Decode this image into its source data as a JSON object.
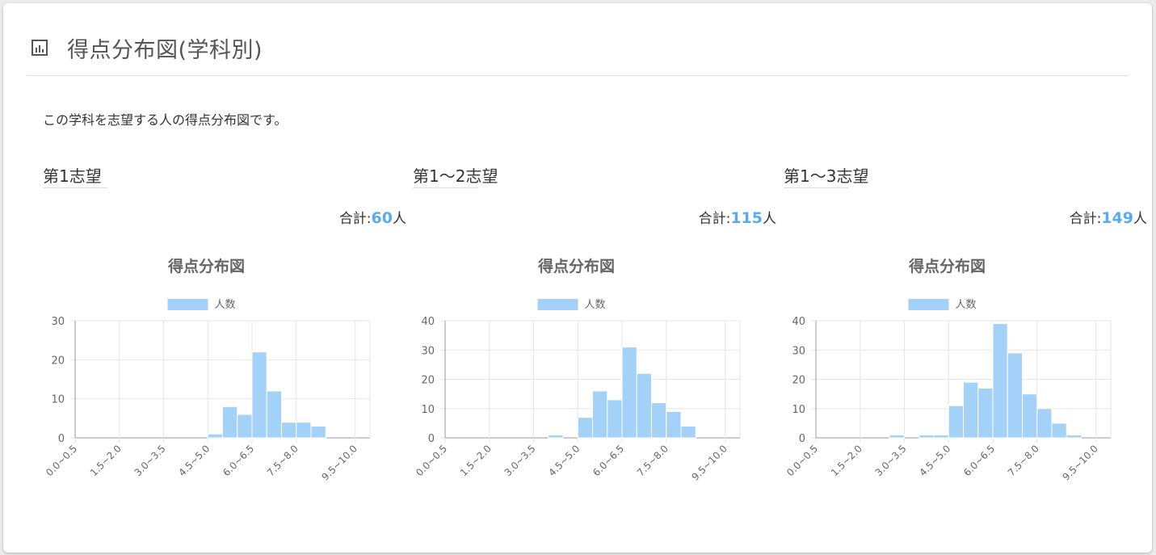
{
  "header": {
    "title": "得点分布図(学科別)",
    "icon": "bar-chart-icon"
  },
  "description": "この学科を志望する人の得点分布図です。",
  "colors": {
    "bar_fill": "#a3d1f7",
    "bar_stroke": "#ffffff",
    "accent": "#5aaaf0",
    "grid": "#e6e6e6",
    "axis": "#999999"
  },
  "panels": [
    {
      "title": "第1志望",
      "total_label": "合計:",
      "total_value": "60",
      "total_unit": "人"
    },
    {
      "title": "第1～2志望",
      "total_label": "合計:",
      "total_value": "115",
      "total_unit": "人"
    },
    {
      "title": "第1～3志望",
      "total_label": "合計:",
      "total_value": "149",
      "total_unit": "人"
    }
  ],
  "chart_data": [
    {
      "type": "bar",
      "title": "得点分布図",
      "categories": [
        "0.0~0.5",
        "0.5~1.0",
        "1.0~1.5",
        "1.5~2.0",
        "2.0~2.5",
        "2.5~3.0",
        "3.0~3.5",
        "3.5~4.0",
        "4.0~4.5",
        "4.5~5.0",
        "5.0~5.5",
        "5.5~6.0",
        "6.0~6.5",
        "6.5~7.0",
        "7.0~7.5",
        "7.5~8.0",
        "8.0~8.5",
        "8.5~9.0",
        "9.0~9.5",
        "9.5~10.0"
      ],
      "tick_labels": [
        "0.0~0.5",
        "1.5~2.0",
        "3.0~3.5",
        "4.5~5.0",
        "6.0~6.5",
        "7.5~8.0",
        "9.5~10.0"
      ],
      "series": [
        {
          "name": "人数",
          "values": [
            0,
            0,
            0,
            0,
            0,
            0,
            0,
            0,
            0,
            1,
            8,
            6,
            22,
            12,
            4,
            4,
            3,
            0,
            0,
            0
          ]
        }
      ],
      "ylim": [
        0,
        30
      ],
      "yticks": [
        0,
        10,
        20,
        30
      ],
      "legend": "top",
      "grid": true
    },
    {
      "type": "bar",
      "title": "得点分布図",
      "categories": [
        "0.0~0.5",
        "0.5~1.0",
        "1.0~1.5",
        "1.5~2.0",
        "2.0~2.5",
        "2.5~3.0",
        "3.0~3.5",
        "3.5~4.0",
        "4.0~4.5",
        "4.5~5.0",
        "5.0~5.5",
        "5.5~6.0",
        "6.0~6.5",
        "6.5~7.0",
        "7.0~7.5",
        "7.5~8.0",
        "8.0~8.5",
        "8.5~9.0",
        "9.0~9.5",
        "9.5~10.0"
      ],
      "tick_labels": [
        "0.0~0.5",
        "1.5~2.0",
        "3.0~3.5",
        "4.5~5.0",
        "6.0~6.5",
        "7.5~8.0",
        "9.5~10.0"
      ],
      "series": [
        {
          "name": "人数",
          "values": [
            0,
            0,
            0,
            0,
            0,
            0,
            0,
            1,
            0,
            7,
            16,
            13,
            31,
            22,
            12,
            9,
            4,
            0,
            0,
            0
          ]
        }
      ],
      "ylim": [
        0,
        40
      ],
      "yticks": [
        0,
        10,
        20,
        30,
        40
      ],
      "legend": "top",
      "grid": true
    },
    {
      "type": "bar",
      "title": "得点分布図",
      "categories": [
        "0.0~0.5",
        "0.5~1.0",
        "1.0~1.5",
        "1.5~2.0",
        "2.0~2.5",
        "2.5~3.0",
        "3.0~3.5",
        "3.5~4.0",
        "4.0~4.5",
        "4.5~5.0",
        "5.0~5.5",
        "5.5~6.0",
        "6.0~6.5",
        "6.5~7.0",
        "7.0~7.5",
        "7.5~8.0",
        "8.0~8.5",
        "8.5~9.0",
        "9.0~9.5",
        "9.5~10.0"
      ],
      "tick_labels": [
        "0.0~0.5",
        "1.5~2.0",
        "3.0~3.5",
        "4.5~5.0",
        "6.0~6.5",
        "7.5~8.0",
        "9.5~10.0"
      ],
      "series": [
        {
          "name": "人数",
          "values": [
            0,
            0,
            0,
            0,
            0,
            1,
            0,
            1,
            1,
            11,
            19,
            17,
            39,
            29,
            15,
            10,
            5,
            1,
            0,
            0
          ]
        }
      ],
      "ylim": [
        0,
        40
      ],
      "yticks": [
        0,
        10,
        20,
        30,
        40
      ],
      "legend": "top",
      "grid": true
    }
  ]
}
